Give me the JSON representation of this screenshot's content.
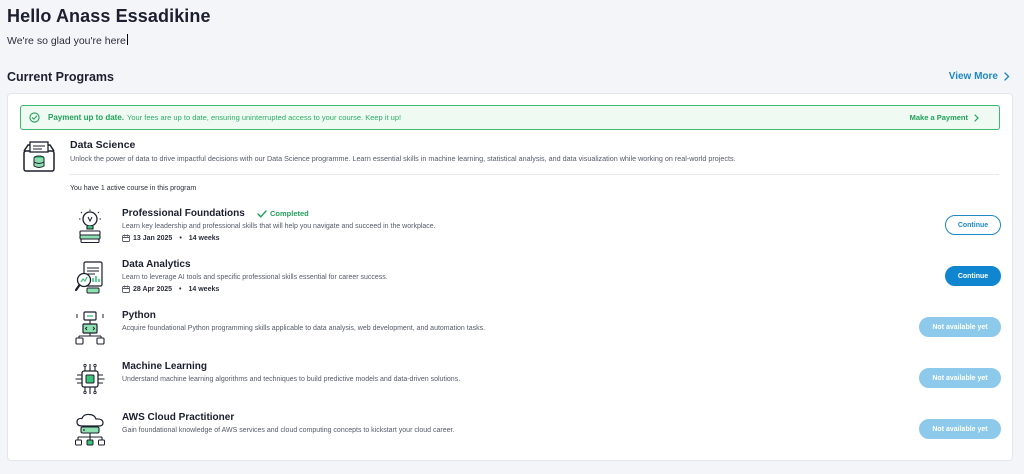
{
  "header": {
    "greeting": "Hello Anass Essadikine",
    "subtitle": "We're so glad you're here"
  },
  "section": {
    "title": "Current Programs",
    "view_more": "View More"
  },
  "banner": {
    "title": "Payment up to date.",
    "text": "Your fees are up to date, ensuring uninterrupted access to your course. Keep it up!",
    "action": "Make a Payment"
  },
  "program": {
    "title": "Data Science",
    "description": "Unlock the power of data to drive impactful decisions with our Data Science programme. Learn essential skills in machine learning, statistical analysis, and data visualization while working on real-world projects.",
    "active_note": "You have 1 active course in this program"
  },
  "courses": [
    {
      "title": "Professional Foundations",
      "status": "Completed",
      "description": "Learn key leadership and professional skills that will help you navigate and succeed in the workplace.",
      "date": "13 Jan 2025",
      "duration": "14 weeks",
      "button": "Continue",
      "icon": "lightbulb-book-icon"
    },
    {
      "title": "Data Analytics",
      "status": "",
      "description": "Learn to leverage AI tools and specific professional skills essential for career success.",
      "date": "28 Apr 2025",
      "duration": "14 weeks",
      "button": "Continue",
      "icon": "magnifier-chart-icon"
    },
    {
      "title": "Python",
      "status": "",
      "description": "Acquire foundational Python programming skills applicable to data analysis, web development, and automation tasks.",
      "date": "",
      "duration": "",
      "button": "Not available yet",
      "icon": "flowchart-icon"
    },
    {
      "title": "Machine Learning",
      "status": "",
      "description": "Understand machine learning algorithms and techniques to build predictive models and data-driven solutions.",
      "date": "",
      "duration": "",
      "button": "Not available yet",
      "icon": "chip-icon"
    },
    {
      "title": "AWS Cloud Practitioner",
      "status": "",
      "description": "Gain foundational knowledge of AWS services and cloud computing concepts to kickstart your cloud career.",
      "date": "",
      "duration": "",
      "button": "Not available yet",
      "icon": "cloud-server-icon"
    }
  ],
  "colors": {
    "accent": "#0f86cf",
    "success": "#23a05a",
    "disabled": "#8cc9ea"
  }
}
